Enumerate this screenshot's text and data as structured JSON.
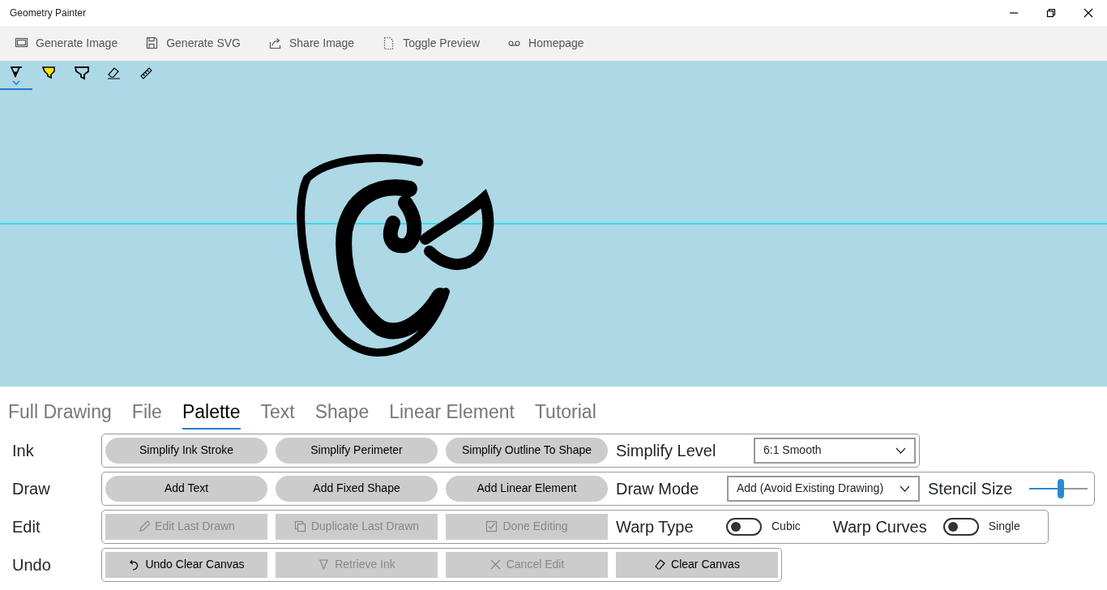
{
  "window": {
    "title": "Geometry Painter"
  },
  "toolbar": [
    {
      "label": "Generate Image"
    },
    {
      "label": "Generate SVG"
    },
    {
      "label": "Share Image"
    },
    {
      "label": "Toggle Preview"
    },
    {
      "label": "Homepage"
    }
  ],
  "ink_tools": [
    {
      "selected": true
    },
    {
      "selected": false
    },
    {
      "selected": false
    },
    {
      "selected": false
    },
    {
      "selected": false
    }
  ],
  "tabs": [
    {
      "label": "Full Drawing",
      "selected": false
    },
    {
      "label": "File",
      "selected": false
    },
    {
      "label": "Palette",
      "selected": true
    },
    {
      "label": "Text",
      "selected": false
    },
    {
      "label": "Shape",
      "selected": false
    },
    {
      "label": "Linear Element",
      "selected": false
    },
    {
      "label": "Tutorial",
      "selected": false
    }
  ],
  "rows": [
    {
      "label": "Ink",
      "items": [
        {
          "kind": "pill",
          "label": "Simplify Ink Stroke",
          "disabled": false
        },
        {
          "kind": "pill",
          "label": "Simplify Perimeter",
          "disabled": false
        },
        {
          "kind": "pill",
          "label": "Simplify Outline To Shape",
          "disabled": false
        },
        {
          "kind": "label",
          "text": "Simplify Level"
        },
        {
          "kind": "dropdown",
          "value": "6:1 Smooth"
        }
      ]
    },
    {
      "label": "Draw",
      "items": [
        {
          "kind": "pill",
          "label": "Add Text",
          "disabled": false
        },
        {
          "kind": "pill",
          "label": "Add Fixed Shape",
          "disabled": false
        },
        {
          "kind": "pill",
          "label": "Add Linear Element",
          "disabled": false
        },
        {
          "kind": "label",
          "text": "Draw Mode"
        },
        {
          "kind": "dropdown",
          "value": "Add (Avoid Existing Drawing)"
        },
        {
          "kind": "label",
          "text": "Stencil Size"
        },
        {
          "kind": "slider",
          "level": 0.55
        }
      ]
    },
    {
      "label": "Edit",
      "items": [
        {
          "kind": "button",
          "label": "Edit Last Drawn",
          "disabled": true
        },
        {
          "kind": "button",
          "label": "Duplicate Last Drawn",
          "disabled": true
        },
        {
          "kind": "button",
          "label": "Done Editing",
          "disabled": true
        },
        {
          "kind": "label",
          "text": "Warp Type"
        },
        {
          "kind": "toggle",
          "on": false,
          "text": "Cubic"
        },
        {
          "kind": "label",
          "text": "Warp Curves"
        },
        {
          "kind": "toggle",
          "on": false,
          "text": "Single"
        }
      ]
    },
    {
      "label": "Undo",
      "items": [
        {
          "kind": "button",
          "label": "Undo Clear Canvas",
          "disabled": false
        },
        {
          "kind": "button",
          "label": "Retrieve Ink",
          "disabled": true
        },
        {
          "kind": "button",
          "label": "Cancel Edit",
          "disabled": true
        },
        {
          "kind": "button",
          "label": "Clear Canvas",
          "disabled": false
        }
      ]
    }
  ]
}
